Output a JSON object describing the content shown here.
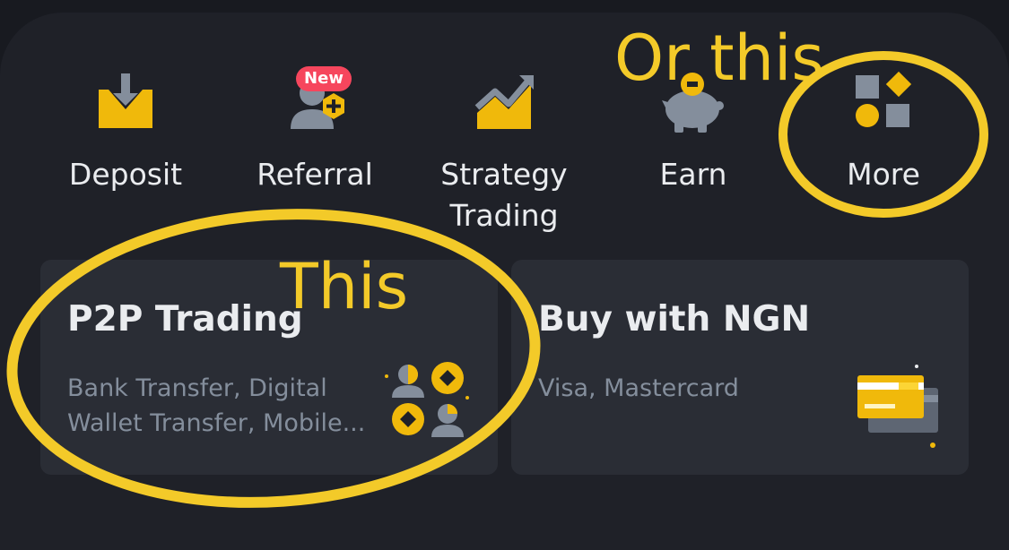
{
  "shortcuts": [
    {
      "label": "Deposit",
      "icon": "deposit-icon"
    },
    {
      "label": "Referral",
      "icon": "referral-icon",
      "badge": "New"
    },
    {
      "label": "Strategy\nTrading",
      "icon": "strategy-trading-icon"
    },
    {
      "label": "Earn",
      "icon": "piggy-bank-icon"
    },
    {
      "label": "More",
      "icon": "more-grid-icon"
    }
  ],
  "cards": [
    {
      "title": "P2P Trading",
      "subtitle": "Bank Transfer, Digital Wallet Transfer, Mobile...",
      "icon": "p2p-users-coins-icon"
    },
    {
      "title": "Buy with NGN",
      "subtitle": "Visa, Mastercard",
      "icon": "credit-card-icon"
    }
  ],
  "annotations": {
    "or_this": "Or this",
    "this": "This"
  },
  "colors": {
    "background": "#181a20",
    "panel": "#1f2128",
    "card": "#2a2d35",
    "accent": "#f0b90b",
    "annotation": "#f3ca29",
    "badge": "#f6465d",
    "icon_gray": "#848e9c"
  }
}
